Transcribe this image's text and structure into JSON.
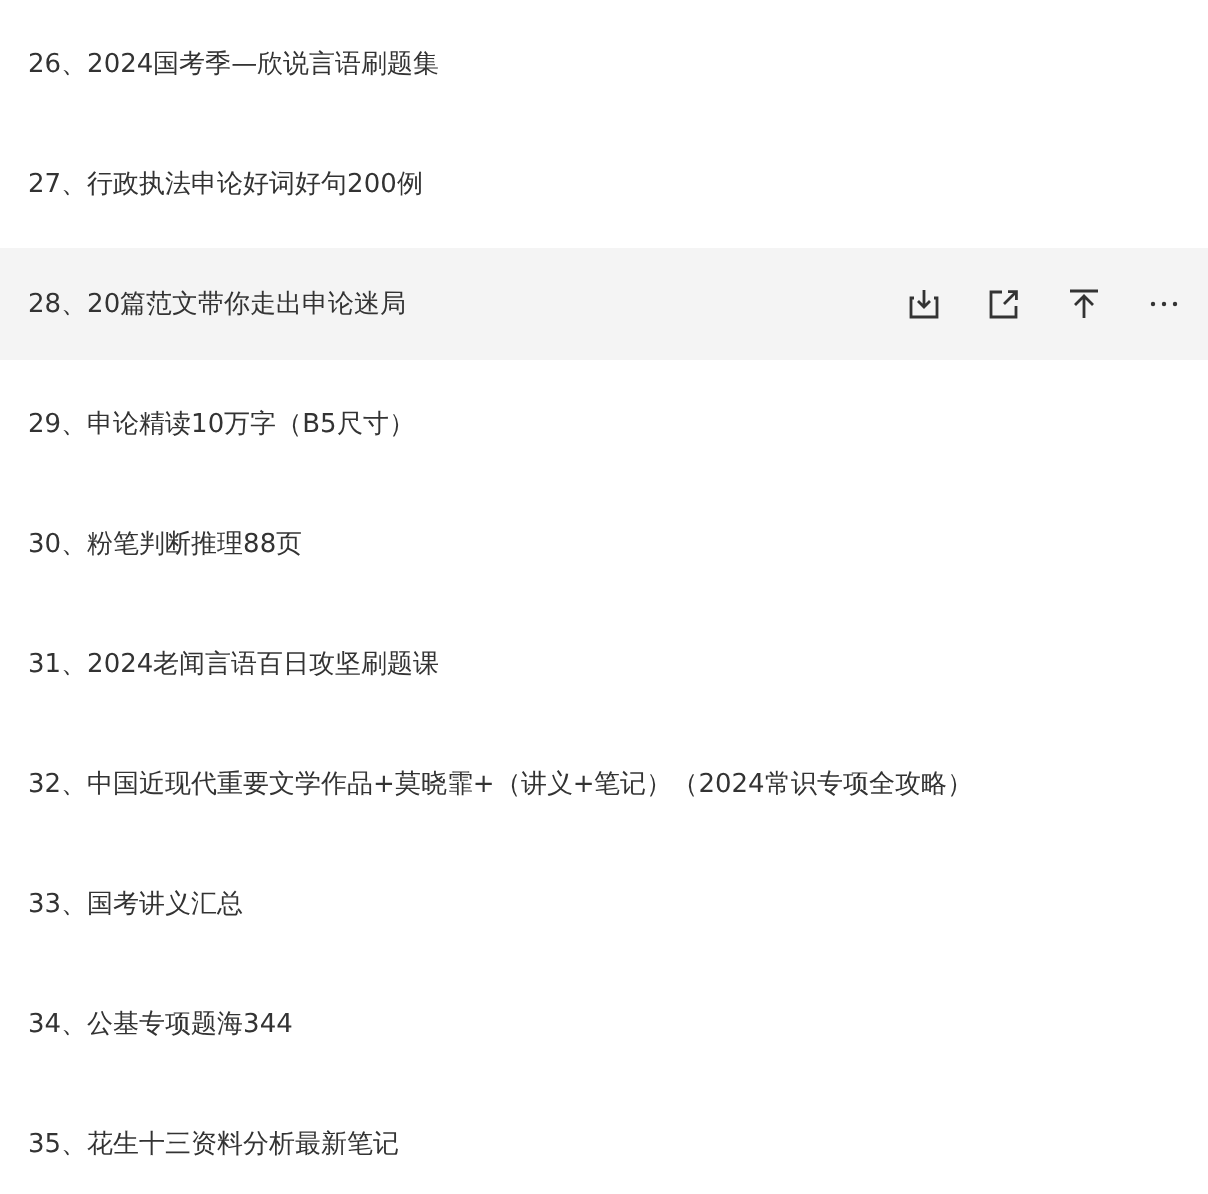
{
  "items": [
    {
      "label": "26、2024国考季—欣说言语刷题集",
      "hovered": false
    },
    {
      "label": "27、行政执法申论好词好句200例",
      "hovered": false
    },
    {
      "label": "28、20篇范文带你走出申论迷局",
      "hovered": true
    },
    {
      "label": "29、申论精读10万字（B5尺寸）",
      "hovered": false
    },
    {
      "label": "30、粉笔判断推理88页",
      "hovered": false
    },
    {
      "label": "31、2024老闻言语百日攻坚刷题课",
      "hovered": false
    },
    {
      "label": "32、中国近现代重要文学作品+莫晓霏+（讲义+笔记）（2024常识专项全攻略）",
      "hovered": false
    },
    {
      "label": "33、国考讲义汇总",
      "hovered": false
    },
    {
      "label": "34、公基专项题海344",
      "hovered": false
    },
    {
      "label": "35、花生十三资料分析最新笔记",
      "hovered": false
    }
  ]
}
